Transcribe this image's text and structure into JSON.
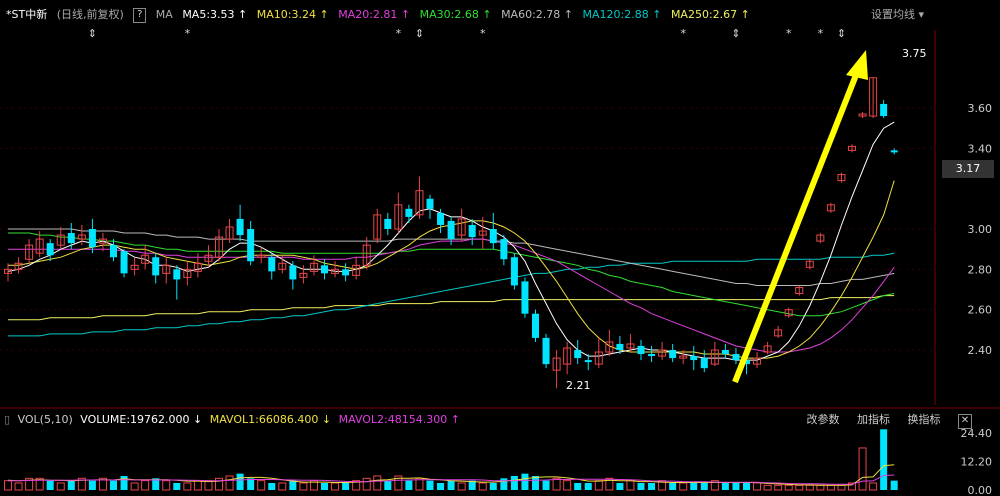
{
  "header": {
    "stock_name": "*ST中新",
    "period": "(日线,前复权)",
    "q_label": "?",
    "ma_label": "MA",
    "ma5": "MA5:3.53 ↑",
    "ma10": "MA10:3.24 ↑",
    "ma20": "MA20:2.81 ↑",
    "ma30": "MA30:2.68 ↑",
    "ma60": "MA60:2.78 ↑",
    "ma120": "MA120:2.88 ↑",
    "ma250": "MA250:2.67 ↑",
    "settings": "设置均线 ▾"
  },
  "colors": {
    "up": "#e8464a",
    "down": "#00e5ff",
    "ma5": "#ffffff",
    "ma10": "#f0e040",
    "ma20": "#e040e0",
    "ma30": "#30e030",
    "ma60": "#bbbbbb",
    "ma120": "#00c8c8",
    "ma250": "#f0f060",
    "arrow": "#ffff00"
  },
  "price_badge": "3.17",
  "volume_bar": {
    "vol_label": "VOL(5,10)",
    "volume": "VOLUME:19762.000 ↓",
    "mavol1": "MAVOL1:66086.400 ↓",
    "mavol2": "MAVOL2:48154.300 ↑",
    "btn_params": "改参数",
    "btn_add": "加指标",
    "btn_switch": "换指标",
    "close": "✕"
  },
  "chart_data": {
    "type": "candlestick",
    "y_ticks": [
      "3.60",
      "3.40",
      "3.00",
      "2.80",
      "2.60",
      "2.40"
    ],
    "y_tick_values": [
      3.6,
      3.4,
      3.0,
      2.8,
      2.6,
      2.4
    ],
    "vol_ticks": [
      "24.40",
      "12.20",
      "0.00"
    ],
    "vol_tick_values": [
      24.4,
      12.2,
      0
    ],
    "annotations": {
      "high": "3.75",
      "low": "2.21"
    },
    "candles": [
      [
        2.78,
        2.8,
        2.83,
        2.74
      ],
      [
        2.8,
        2.83,
        2.86,
        2.78
      ],
      [
        2.85,
        2.92,
        2.95,
        2.83
      ],
      [
        2.88,
        2.95,
        2.99,
        2.86
      ],
      [
        2.93,
        2.87,
        2.95,
        2.84
      ],
      [
        2.92,
        2.97,
        3.01,
        2.9
      ],
      [
        2.98,
        2.93,
        3.03,
        2.9
      ],
      [
        2.95,
        2.97,
        3.02,
        2.92
      ],
      [
        3.0,
        2.91,
        3.05,
        2.88
      ],
      [
        2.93,
        2.95,
        2.98,
        2.89
      ],
      [
        2.92,
        2.86,
        2.95,
        2.84
      ],
      [
        2.89,
        2.78,
        2.9,
        2.76
      ],
      [
        2.8,
        2.82,
        2.86,
        2.77
      ],
      [
        2.83,
        2.87,
        2.92,
        2.8
      ],
      [
        2.86,
        2.77,
        2.88,
        2.73
      ],
      [
        2.78,
        2.82,
        2.86,
        2.73
      ],
      [
        2.8,
        2.75,
        2.82,
        2.65
      ],
      [
        2.76,
        2.8,
        2.84,
        2.72
      ],
      [
        2.79,
        2.83,
        2.88,
        2.76
      ],
      [
        2.84,
        2.87,
        2.92,
        2.81
      ],
      [
        2.86,
        2.96,
        3.0,
        2.84
      ],
      [
        2.95,
        3.01,
        3.05,
        2.93
      ],
      [
        3.05,
        2.97,
        3.12,
        2.94
      ],
      [
        3.0,
        2.84,
        3.04,
        2.82
      ],
      [
        2.86,
        2.87,
        2.91,
        2.83
      ],
      [
        2.86,
        2.79,
        2.88,
        2.75
      ],
      [
        2.8,
        2.83,
        2.87,
        2.78
      ],
      [
        2.82,
        2.75,
        2.84,
        2.7
      ],
      [
        2.76,
        2.78,
        2.82,
        2.73
      ],
      [
        2.79,
        2.83,
        2.87,
        2.77
      ],
      [
        2.82,
        2.78,
        2.85,
        2.75
      ],
      [
        2.78,
        2.8,
        2.84,
        2.76
      ],
      [
        2.8,
        2.77,
        2.83,
        2.74
      ],
      [
        2.77,
        2.82,
        2.86,
        2.75
      ],
      [
        2.82,
        2.92,
        2.96,
        2.8
      ],
      [
        2.95,
        3.07,
        3.1,
        2.93
      ],
      [
        3.05,
        3.0,
        3.08,
        2.97
      ],
      [
        3.0,
        3.12,
        3.18,
        2.98
      ],
      [
        3.1,
        3.06,
        3.12,
        3.03
      ],
      [
        3.07,
        3.19,
        3.26,
        3.05
      ],
      [
        3.15,
        3.1,
        3.17,
        3.05
      ],
      [
        3.08,
        3.02,
        3.1,
        2.98
      ],
      [
        3.04,
        2.95,
        3.06,
        2.92
      ],
      [
        2.97,
        3.05,
        3.1,
        2.94
      ],
      [
        3.02,
        2.96,
        3.05,
        2.92
      ],
      [
        2.97,
        2.99,
        3.06,
        2.9
      ],
      [
        3.0,
        2.93,
        3.08,
        2.9
      ],
      [
        2.95,
        2.85,
        2.97,
        2.82
      ],
      [
        2.86,
        2.72,
        2.88,
        2.7
      ],
      [
        2.74,
        2.58,
        2.76,
        2.56
      ],
      [
        2.58,
        2.46,
        2.6,
        2.44
      ],
      [
        2.46,
        2.33,
        2.48,
        2.31
      ],
      [
        2.3,
        2.36,
        2.4,
        2.21
      ],
      [
        2.33,
        2.41,
        2.44,
        2.28
      ],
      [
        2.4,
        2.36,
        2.45,
        2.33
      ],
      [
        2.35,
        2.34,
        2.38,
        2.3
      ],
      [
        2.33,
        2.39,
        2.46,
        2.31
      ],
      [
        2.39,
        2.44,
        2.5,
        2.37
      ],
      [
        2.43,
        2.4,
        2.47,
        2.38
      ],
      [
        2.41,
        2.43,
        2.48,
        2.39
      ],
      [
        2.42,
        2.38,
        2.45,
        2.35
      ],
      [
        2.38,
        2.37,
        2.42,
        2.34
      ],
      [
        2.37,
        2.4,
        2.44,
        2.35
      ],
      [
        2.4,
        2.36,
        2.43,
        2.34
      ],
      [
        2.36,
        2.37,
        2.4,
        2.33
      ],
      [
        2.37,
        2.35,
        2.42,
        2.3
      ],
      [
        2.36,
        2.31,
        2.4,
        2.29
      ],
      [
        2.33,
        2.4,
        2.44,
        2.32
      ],
      [
        2.4,
        2.38,
        2.43,
        2.36
      ],
      [
        2.38,
        2.35,
        2.41,
        2.33
      ],
      [
        2.35,
        2.33,
        2.38,
        2.28
      ],
      [
        2.33,
        2.36,
        2.39,
        2.31
      ],
      [
        2.39,
        2.42,
        2.44,
        2.38
      ],
      [
        2.47,
        2.5,
        2.52,
        2.46
      ],
      [
        2.57,
        2.6,
        2.61,
        2.56
      ],
      [
        2.68,
        2.71,
        2.72,
        2.67
      ],
      [
        2.81,
        2.84,
        2.85,
        2.8
      ],
      [
        2.94,
        2.97,
        2.98,
        2.93
      ],
      [
        3.09,
        3.12,
        3.13,
        3.08
      ],
      [
        3.24,
        3.27,
        3.28,
        3.23
      ],
      [
        3.39,
        3.41,
        3.42,
        3.38
      ],
      [
        3.56,
        3.57,
        3.58,
        3.55
      ],
      [
        3.56,
        3.75,
        3.75,
        3.55
      ],
      [
        3.62,
        3.56,
        3.64,
        3.55
      ],
      [
        3.39,
        3.38,
        3.4,
        3.37
      ]
    ],
    "ma": {
      "ma5": [
        2.79,
        2.8,
        2.82,
        2.85,
        2.87,
        2.9,
        2.92,
        2.94,
        2.93,
        2.94,
        2.92,
        2.89,
        2.86,
        2.85,
        2.82,
        2.82,
        2.81,
        2.79,
        2.8,
        2.81,
        2.85,
        2.9,
        2.93,
        2.93,
        2.91,
        2.88,
        2.85,
        2.82,
        2.8,
        2.8,
        2.8,
        2.79,
        2.79,
        2.8,
        2.82,
        2.87,
        2.92,
        2.98,
        3.04,
        3.09,
        3.1,
        3.08,
        3.06,
        3.06,
        3.04,
        3.01,
        2.99,
        2.96,
        2.91,
        2.84,
        2.73,
        2.63,
        2.53,
        2.45,
        2.4,
        2.37,
        2.37,
        2.38,
        2.39,
        2.4,
        2.41,
        2.4,
        2.4,
        2.39,
        2.38,
        2.37,
        2.36,
        2.36,
        2.36,
        2.35,
        2.35,
        2.35,
        2.37,
        2.39,
        2.44,
        2.52,
        2.62,
        2.74,
        2.87,
        3.02,
        3.16,
        3.29,
        3.42,
        3.5,
        3.53
      ],
      "ma10": [
        2.82,
        2.82,
        2.83,
        2.84,
        2.85,
        2.86,
        2.88,
        2.9,
        2.91,
        2.92,
        2.92,
        2.91,
        2.9,
        2.9,
        2.88,
        2.86,
        2.85,
        2.84,
        2.83,
        2.82,
        2.83,
        2.84,
        2.86,
        2.87,
        2.87,
        2.87,
        2.87,
        2.87,
        2.86,
        2.85,
        2.83,
        2.82,
        2.81,
        2.8,
        2.81,
        2.83,
        2.86,
        2.89,
        2.92,
        2.96,
        2.99,
        3.01,
        3.02,
        3.03,
        3.04,
        3.04,
        3.03,
        3.01,
        2.98,
        2.94,
        2.88,
        2.81,
        2.74,
        2.66,
        2.58,
        2.51,
        2.46,
        2.42,
        2.4,
        2.39,
        2.39,
        2.39,
        2.39,
        2.39,
        2.39,
        2.39,
        2.38,
        2.38,
        2.38,
        2.37,
        2.36,
        2.36,
        2.36,
        2.37,
        2.39,
        2.42,
        2.46,
        2.52,
        2.59,
        2.67,
        2.76,
        2.86,
        2.96,
        3.07,
        3.24
      ],
      "ma20": [
        2.9,
        2.9,
        2.9,
        2.9,
        2.9,
        2.9,
        2.9,
        2.9,
        2.9,
        2.9,
        2.9,
        2.89,
        2.89,
        2.88,
        2.88,
        2.87,
        2.87,
        2.86,
        2.86,
        2.86,
        2.86,
        2.86,
        2.86,
        2.86,
        2.86,
        2.86,
        2.86,
        2.86,
        2.85,
        2.85,
        2.85,
        2.85,
        2.85,
        2.86,
        2.86,
        2.87,
        2.88,
        2.89,
        2.9,
        2.92,
        2.93,
        2.94,
        2.94,
        2.94,
        2.95,
        2.95,
        2.94,
        2.93,
        2.92,
        2.9,
        2.88,
        2.86,
        2.84,
        2.81,
        2.78,
        2.75,
        2.72,
        2.69,
        2.66,
        2.63,
        2.61,
        2.58,
        2.56,
        2.54,
        2.52,
        2.5,
        2.48,
        2.46,
        2.44,
        2.42,
        2.41,
        2.4,
        2.39,
        2.39,
        2.39,
        2.4,
        2.41,
        2.43,
        2.46,
        2.5,
        2.55,
        2.61,
        2.67,
        2.74,
        2.81
      ],
      "ma30": [
        2.98,
        2.98,
        2.98,
        2.97,
        2.97,
        2.96,
        2.96,
        2.95,
        2.95,
        2.94,
        2.94,
        2.93,
        2.92,
        2.92,
        2.91,
        2.9,
        2.9,
        2.89,
        2.89,
        2.89,
        2.89,
        2.89,
        2.89,
        2.89,
        2.89,
        2.89,
        2.88,
        2.88,
        2.88,
        2.88,
        2.88,
        2.88,
        2.88,
        2.88,
        2.88,
        2.88,
        2.88,
        2.89,
        2.89,
        2.9,
        2.9,
        2.9,
        2.9,
        2.9,
        2.9,
        2.9,
        2.9,
        2.89,
        2.88,
        2.87,
        2.86,
        2.85,
        2.84,
        2.83,
        2.82,
        2.8,
        2.79,
        2.77,
        2.76,
        2.74,
        2.73,
        2.72,
        2.71,
        2.69,
        2.68,
        2.67,
        2.66,
        2.65,
        2.64,
        2.63,
        2.62,
        2.61,
        2.6,
        2.59,
        2.58,
        2.57,
        2.57,
        2.57,
        2.58,
        2.59,
        2.61,
        2.63,
        2.65,
        2.67,
        2.68
      ],
      "ma60": [
        3.0,
        3.0,
        3.0,
        3.0,
        3.0,
        3.0,
        3.0,
        2.99,
        2.99,
        2.99,
        2.99,
        2.98,
        2.98,
        2.98,
        2.97,
        2.97,
        2.96,
        2.96,
        2.96,
        2.95,
        2.95,
        2.95,
        2.95,
        2.94,
        2.94,
        2.94,
        2.94,
        2.94,
        2.94,
        2.94,
        2.94,
        2.94,
        2.94,
        2.94,
        2.94,
        2.94,
        2.94,
        2.95,
        2.95,
        2.95,
        2.95,
        2.95,
        2.95,
        2.95,
        2.95,
        2.95,
        2.94,
        2.94,
        2.93,
        2.93,
        2.92,
        2.91,
        2.9,
        2.89,
        2.88,
        2.87,
        2.86,
        2.85,
        2.84,
        2.83,
        2.82,
        2.81,
        2.8,
        2.79,
        2.78,
        2.77,
        2.76,
        2.75,
        2.74,
        2.73,
        2.73,
        2.72,
        2.72,
        2.72,
        2.72,
        2.72,
        2.72,
        2.73,
        2.73,
        2.74,
        2.75,
        2.75,
        2.76,
        2.77,
        2.78
      ],
      "ma120": [
        2.47,
        2.47,
        2.47,
        2.47,
        2.48,
        2.48,
        2.48,
        2.48,
        2.49,
        2.49,
        2.49,
        2.5,
        2.5,
        2.5,
        2.51,
        2.51,
        2.51,
        2.52,
        2.52,
        2.53,
        2.53,
        2.54,
        2.54,
        2.55,
        2.55,
        2.56,
        2.56,
        2.57,
        2.57,
        2.58,
        2.59,
        2.6,
        2.6,
        2.61,
        2.62,
        2.63,
        2.64,
        2.65,
        2.66,
        2.67,
        2.68,
        2.69,
        2.7,
        2.71,
        2.72,
        2.73,
        2.74,
        2.75,
        2.76,
        2.77,
        2.78,
        2.78,
        2.79,
        2.8,
        2.8,
        2.81,
        2.81,
        2.82,
        2.82,
        2.83,
        2.83,
        2.83,
        2.83,
        2.84,
        2.84,
        2.84,
        2.84,
        2.84,
        2.84,
        2.84,
        2.84,
        2.85,
        2.85,
        2.85,
        2.85,
        2.85,
        2.85,
        2.85,
        2.86,
        2.86,
        2.86,
        2.86,
        2.87,
        2.87,
        2.88
      ],
      "ma250": [
        2.55,
        2.55,
        2.55,
        2.55,
        2.56,
        2.56,
        2.56,
        2.56,
        2.56,
        2.57,
        2.57,
        2.57,
        2.57,
        2.57,
        2.58,
        2.58,
        2.58,
        2.58,
        2.58,
        2.59,
        2.59,
        2.59,
        2.59,
        2.6,
        2.6,
        2.6,
        2.6,
        2.61,
        2.61,
        2.61,
        2.61,
        2.62,
        2.62,
        2.62,
        2.62,
        2.62,
        2.63,
        2.63,
        2.63,
        2.63,
        2.63,
        2.64,
        2.64,
        2.64,
        2.64,
        2.64,
        2.64,
        2.65,
        2.65,
        2.65,
        2.65,
        2.65,
        2.65,
        2.65,
        2.65,
        2.65,
        2.65,
        2.65,
        2.65,
        2.65,
        2.65,
        2.65,
        2.65,
        2.65,
        2.65,
        2.65,
        2.65,
        2.65,
        2.65,
        2.65,
        2.65,
        2.65,
        2.65,
        2.65,
        2.65,
        2.65,
        2.65,
        2.65,
        2.66,
        2.66,
        2.66,
        2.66,
        2.66,
        2.67,
        2.67
      ]
    },
    "volumes": [
      4,
      3,
      5,
      5,
      4,
      3,
      4,
      5,
      4,
      5,
      4,
      6,
      3,
      4,
      5,
      4,
      3,
      3,
      4,
      4,
      5,
      6,
      7,
      5,
      4,
      3,
      3,
      4,
      3,
      4,
      3,
      3,
      3,
      4,
      5,
      6,
      4,
      6,
      4,
      5,
      4,
      3,
      4,
      3,
      4,
      3,
      3,
      5,
      6,
      7,
      6,
      4,
      5,
      4,
      3,
      3,
      4,
      5,
      3,
      4,
      3,
      3,
      4,
      3,
      3,
      3,
      3,
      4,
      3,
      3,
      3,
      3,
      2,
      2,
      2,
      2,
      2,
      2,
      2,
      2,
      3,
      18,
      3,
      26,
      4
    ],
    "mavol1": [
      4.2,
      4.0,
      4.2,
      4.4,
      4.2,
      4.1,
      4.0,
      4.2,
      4.3,
      4.4,
      4.3,
      4.8,
      4.4,
      4.4,
      4.4,
      4.4,
      4.2,
      3.8,
      3.8,
      3.6,
      3.8,
      4.4,
      5.2,
      5.4,
      5.4,
      5.0,
      4.4,
      3.8,
      3.4,
      3.4,
      3.4,
      3.2,
      3.2,
      3.4,
      3.6,
      4.2,
      4.4,
      5.0,
      5.0,
      5.2,
      4.6,
      4.4,
      4.0,
      3.8,
      3.6,
      3.4,
      3.4,
      3.8,
      4.2,
      4.8,
      5.4,
      5.6,
      5.6,
      5.2,
      4.6,
      3.8,
      3.8,
      4.2,
      4.0,
      4.0,
      3.6,
      3.6,
      3.4,
      3.2,
      3.2,
      3.2,
      3.2,
      3.2,
      3.2,
      3.2,
      3.2,
      3.2,
      2.8,
      2.6,
      2.4,
      2.2,
      2.2,
      2.0,
      2.0,
      2.0,
      2.2,
      5.4,
      5.6,
      10.4,
      10.8
    ],
    "mavol2": [
      4.0,
      4.0,
      4.1,
      4.2,
      4.2,
      4.2,
      4.2,
      4.3,
      4.3,
      4.3,
      4.3,
      4.4,
      4.3,
      4.3,
      4.3,
      4.3,
      4.3,
      4.2,
      4.1,
      4.0,
      4.0,
      4.1,
      4.3,
      4.5,
      4.5,
      4.5,
      4.4,
      4.3,
      4.2,
      4.2,
      4.1,
      3.9,
      3.7,
      3.6,
      3.5,
      3.8,
      3.9,
      4.2,
      4.3,
      4.4,
      4.4,
      4.4,
      4.4,
      4.4,
      4.4,
      4.3,
      4.0,
      4.0,
      4.0,
      4.1,
      4.2,
      4.3,
      4.5,
      4.5,
      4.6,
      4.6,
      4.6,
      4.6,
      4.5,
      4.4,
      4.2,
      3.9,
      3.8,
      3.8,
      3.6,
      3.5,
      3.5,
      3.4,
      3.3,
      3.3,
      3.3,
      3.3,
      3.1,
      3.0,
      2.8,
      2.7,
      2.7,
      2.6,
      2.5,
      2.5,
      2.5,
      3.8,
      3.9,
      6.2,
      6.4
    ],
    "markers_x_index": [
      8,
      17,
      37,
      39,
      45,
      64,
      69,
      74,
      77,
      79
    ]
  }
}
